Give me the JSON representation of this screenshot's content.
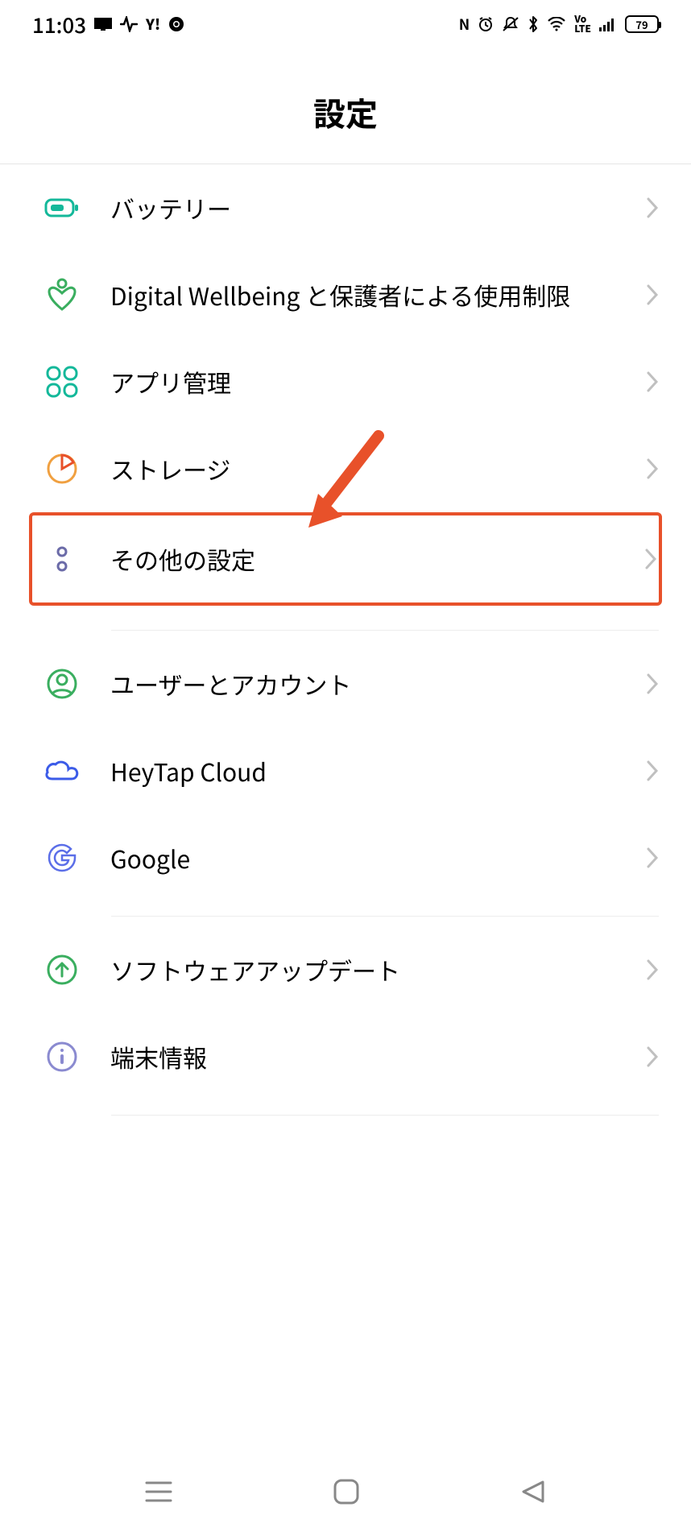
{
  "status": {
    "time": "11:03",
    "battery": "79"
  },
  "header": {
    "title": "設定"
  },
  "items": {
    "battery": {
      "label": "バッテリー"
    },
    "wellbeing": {
      "label": "Digital Wellbeing と保護者による使用制限"
    },
    "apps": {
      "label": "アプリ管理"
    },
    "storage": {
      "label": "ストレージ"
    },
    "other": {
      "label": "その他の設定"
    },
    "users": {
      "label": "ユーザーとアカウント"
    },
    "heytap": {
      "label": "HeyTap Cloud"
    },
    "google": {
      "label": "Google"
    },
    "update": {
      "label": "ソフトウェアアップデート"
    },
    "about": {
      "label": "端末情報"
    }
  }
}
